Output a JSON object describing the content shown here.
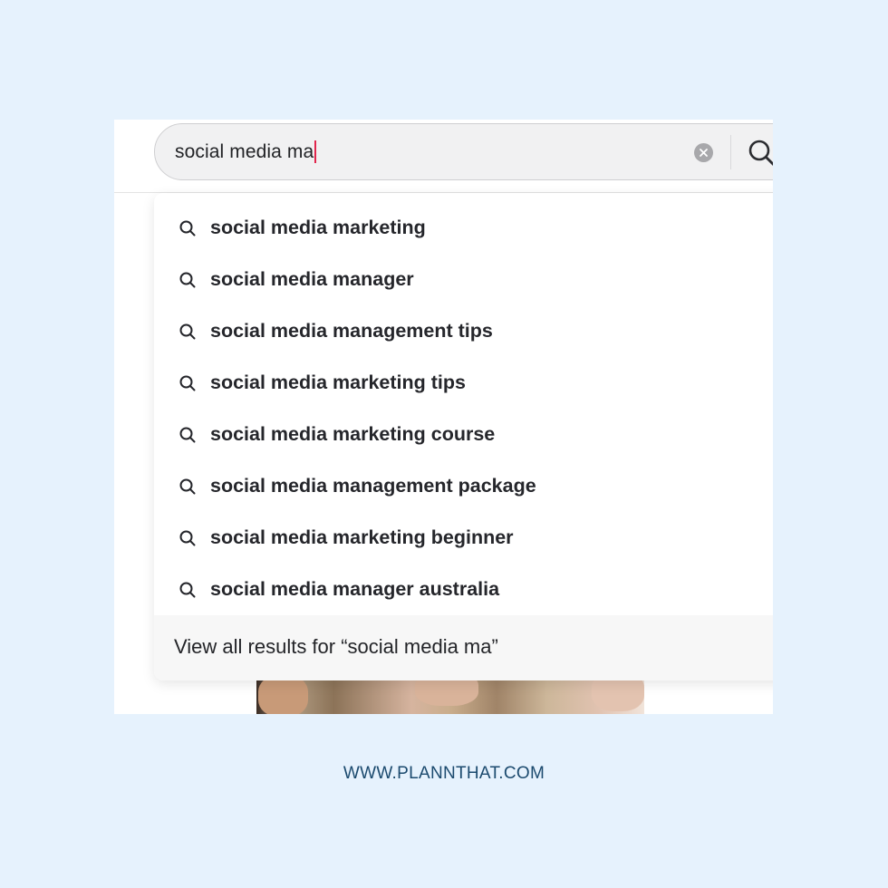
{
  "search": {
    "query": "social media ma",
    "clear_icon": "clear-circle-icon",
    "submit_icon": "search-icon"
  },
  "suggestions": [
    {
      "label": "social media marketing",
      "icon": "search-icon"
    },
    {
      "label": "social media manager",
      "icon": "search-icon"
    },
    {
      "label": "social media management tips",
      "icon": "search-icon"
    },
    {
      "label": "social media marketing tips",
      "icon": "search-icon"
    },
    {
      "label": "social media marketing course",
      "icon": "search-icon"
    },
    {
      "label": "social media management package",
      "icon": "search-icon"
    },
    {
      "label": "social media marketing beginner",
      "icon": "search-icon"
    },
    {
      "label": "social media manager australia",
      "icon": "search-icon"
    }
  ],
  "view_all": {
    "label": "View all results for “social media ma”"
  },
  "footer": {
    "url": "WWW.PLANNTHAT.COM"
  },
  "colors": {
    "background": "#e6f2fd",
    "caret": "#e2264d",
    "footer_text": "#1b4a6e",
    "suggestion_text": "#25262b"
  }
}
